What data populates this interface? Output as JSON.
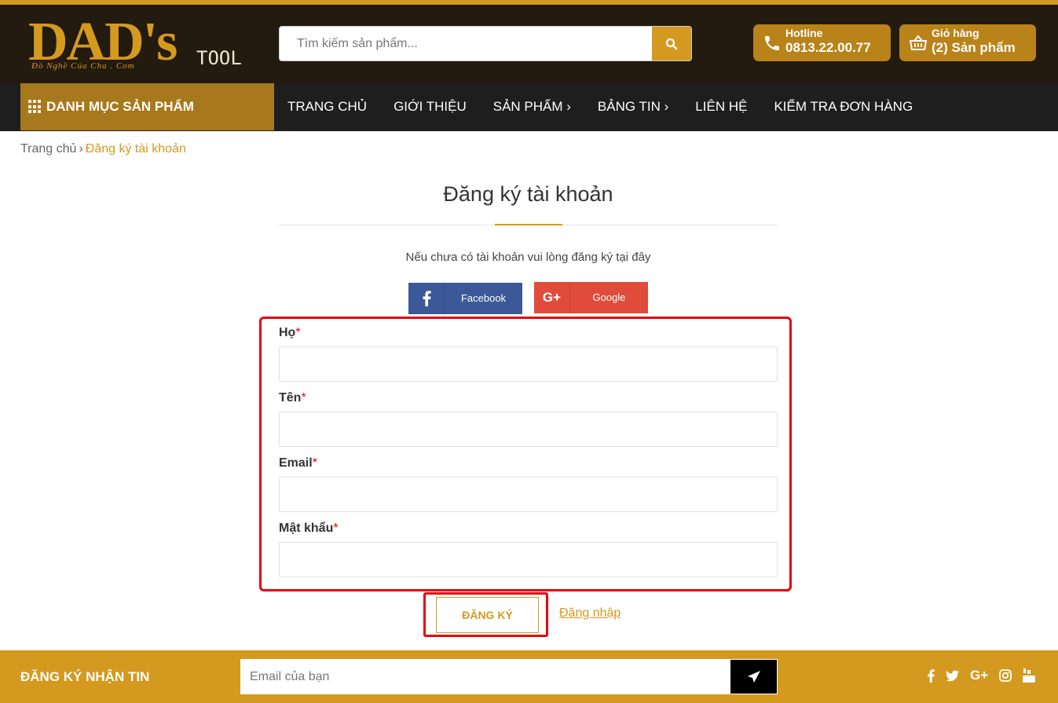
{
  "header": {
    "logo": {
      "main_text": "DAD",
      "suffix": "'s",
      "sub_text": "TOOL",
      "slogan": "Đồ Nghề Của Cha . Com"
    },
    "search": {
      "placeholder": "Tìm kiếm sản phẩm..."
    },
    "hotline": {
      "label": "Hotline",
      "value": "0813.22.00.77"
    },
    "cart": {
      "label": "Giỏ hàng",
      "value": "(2) Sản phẩm"
    }
  },
  "nav": {
    "category_button": "DANH MỤC SẢN PHẨM",
    "items": [
      {
        "label": "TRANG CHỦ"
      },
      {
        "label": "GIỚI THIỆU"
      },
      {
        "label": "SẢN PHẨM ›"
      },
      {
        "label": "BẢNG TIN ›"
      },
      {
        "label": "LIÊN HỆ"
      },
      {
        "label": "KIỂM TRA ĐƠN HÀNG"
      }
    ]
  },
  "breadcrumb": {
    "home": "Trang chủ",
    "separator": "›",
    "current": "Đăng ký tài khoản"
  },
  "register": {
    "title": "Đăng ký tài khoản",
    "intro": "Nếu chưa có tài khoản vui lòng đăng ký tại đây",
    "facebook_label": "Facebook",
    "google_label": "Google",
    "fields": [
      {
        "label": "Họ",
        "required_mark": "*",
        "value": ""
      },
      {
        "label": "Tên",
        "required_mark": "*",
        "value": ""
      },
      {
        "label": "Email",
        "required_mark": "*",
        "value": ""
      },
      {
        "label": "Mật khẩu",
        "required_mark": "*",
        "value": ""
      }
    ],
    "submit_label": "ĐĂNG KÝ",
    "login_link": "Đăng nhập"
  },
  "footer": {
    "newsletter_label": "ĐĂNG KÝ NHẬN TIN",
    "email_placeholder": "Email của bạn",
    "social_icons": [
      "facebook-icon",
      "twitter-icon",
      "google-plus-icon",
      "instagram-icon",
      "youtube-icon"
    ]
  },
  "colors": {
    "accent": "#d4991f",
    "header_bg": "#231a10",
    "nav_bg": "#1e1e1e",
    "highlight": "#e8000b",
    "facebook": "#3b5998",
    "google": "#e14b3c"
  }
}
